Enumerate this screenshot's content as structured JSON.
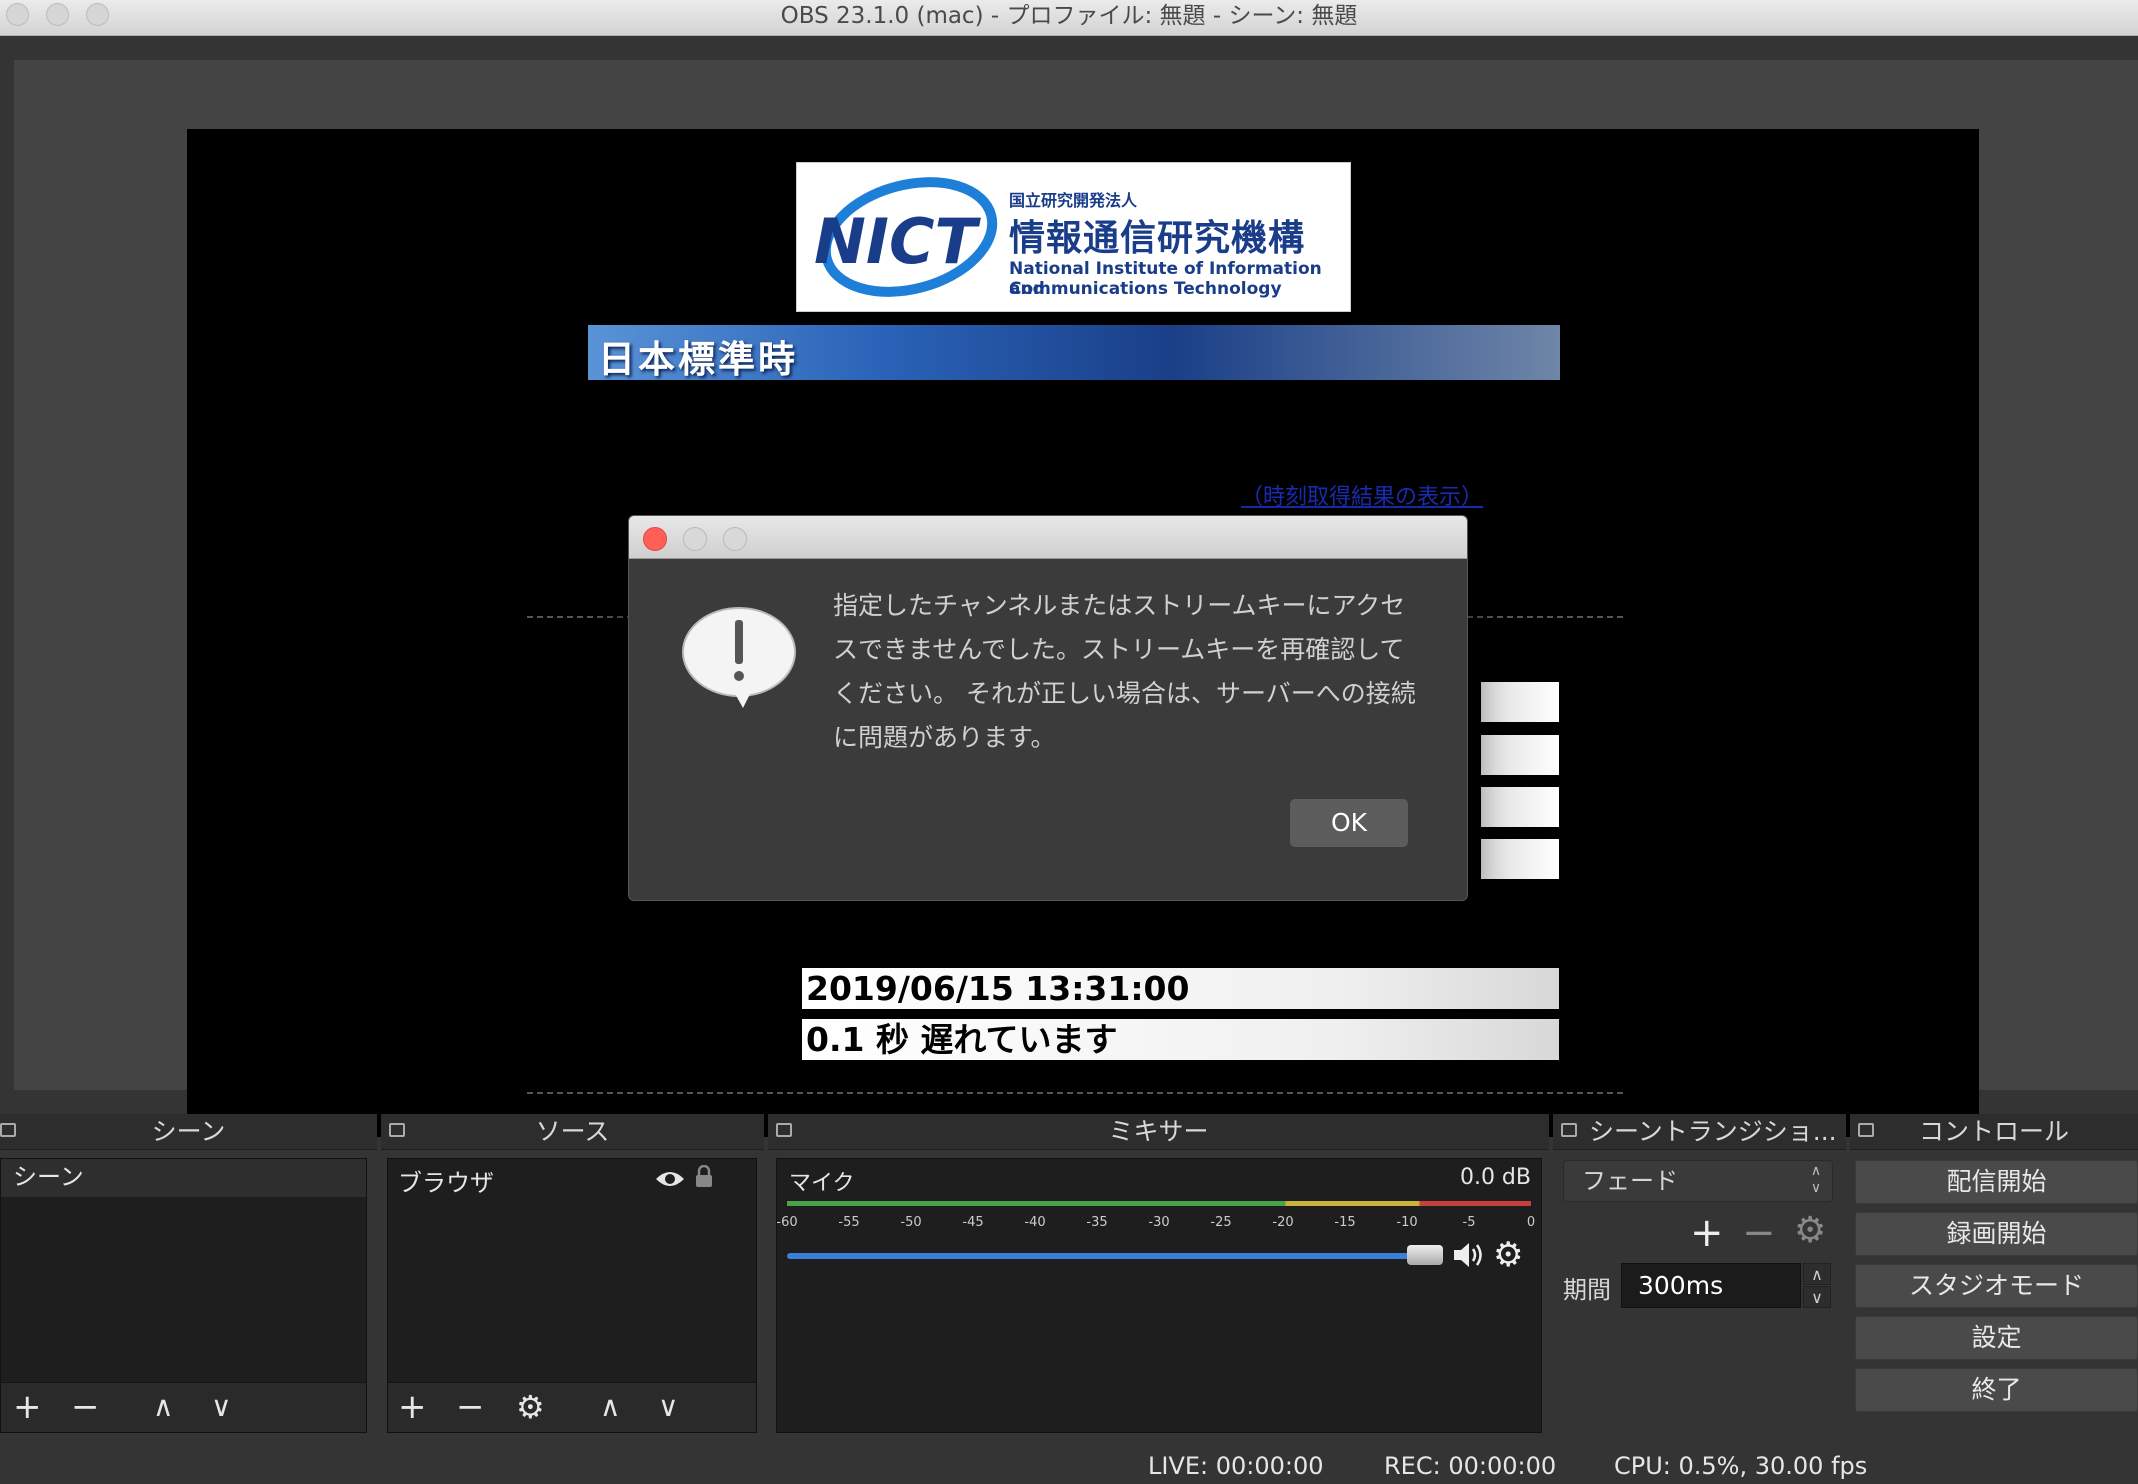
{
  "window": {
    "title": "OBS 23.1.0 (mac) - プロファイル: 無題 - シーン: 無題"
  },
  "preview": {
    "logo": {
      "mark": "NICT",
      "org_type": "国立研究開発法人",
      "org_name": "情報通信研究機構",
      "english_line1": "National Institute of Information and",
      "english_line2": "Communications Technology"
    },
    "banner": "日本標準時",
    "link_text": "（時刻取得結果の表示）",
    "datetime": "2019/06/15 13:31:00",
    "offset": "0.1 秒 遅れています"
  },
  "dialog": {
    "message": "指定したチャンネルまたはストリームキーにアクセスできませんでした。ストリームキーを再確認してください。 それが正しい場合は、サーバーへの接続に問題があります。",
    "ok_label": "OK"
  },
  "docks": {
    "scenes": {
      "title": "シーン",
      "items": [
        "シーン"
      ]
    },
    "sources": {
      "title": "ソース",
      "items": [
        "ブラウザ"
      ]
    },
    "mixer": {
      "title": "ミキサー",
      "channel": "マイク",
      "level": "0.0 dB",
      "ticks": [
        "-60",
        "-55",
        "-50",
        "-45",
        "-40",
        "-35",
        "-30",
        "-25",
        "-20",
        "-15",
        "-10",
        "-5",
        "0"
      ]
    },
    "transitions": {
      "title": "シーントランジショ...",
      "selected": "フェード",
      "duration_label": "期間",
      "duration_value": "300ms"
    },
    "controls": {
      "title": "コントロール",
      "buttons": [
        "配信開始",
        "録画開始",
        "スタジオモード",
        "設定",
        "終了"
      ]
    }
  },
  "status": {
    "live": "LIVE: 00:00:00",
    "rec": "REC: 00:00:00",
    "cpu": "CPU: 0.5%, 30.00 fps"
  },
  "colors": {
    "accent_blue": "#3b7fd6",
    "close_red": "#ff5f57",
    "meter_green": "#4aa34a",
    "meter_yellow": "#c9b13c",
    "meter_red": "#c64040"
  }
}
